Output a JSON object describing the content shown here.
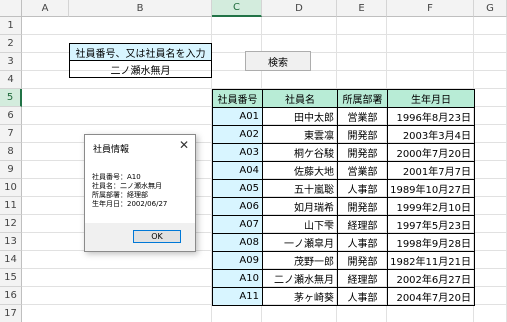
{
  "sheet": {
    "columns": [
      "A",
      "B",
      "C",
      "D",
      "E",
      "F",
      "G"
    ],
    "rows": [
      "1",
      "2",
      "3",
      "4",
      "5",
      "6",
      "7",
      "8",
      "9",
      "10",
      "11",
      "12",
      "13",
      "14",
      "15",
      "16",
      "17"
    ],
    "selected_column": "C",
    "selected_row": "5"
  },
  "search": {
    "label": "社員番号、又は社員名を入力",
    "value": "二ノ瀬水無月",
    "button_label": "検索"
  },
  "table": {
    "headers": [
      "社員番号",
      "社員名",
      "所属部署",
      "生年月日"
    ],
    "rows": [
      [
        "A01",
        "田中太郎",
        "営業部",
        "1996年8月23日"
      ],
      [
        "A02",
        "東雲凛",
        "開発部",
        "2003年3月4日"
      ],
      [
        "A03",
        "桐ケ谷駿",
        "開発部",
        "2000年7月20日"
      ],
      [
        "A04",
        "佐藤大地",
        "営業部",
        "2001年7月7日"
      ],
      [
        "A05",
        "五十嵐聡",
        "人事部",
        "1989年10月27日"
      ],
      [
        "A06",
        "如月瑞希",
        "開発部",
        "1999年2月10日"
      ],
      [
        "A07",
        "山下雫",
        "経理部",
        "1997年5月23日"
      ],
      [
        "A08",
        "一ノ瀬皐月",
        "人事部",
        "1998年9月28日"
      ],
      [
        "A09",
        "茂野一郎",
        "開発部",
        "1982年11月21日"
      ],
      [
        "A10",
        "二ノ瀬水無月",
        "経理部",
        "2002年6月27日"
      ],
      [
        "A11",
        "茅ヶ崎葵",
        "人事部",
        "2004年7月20日"
      ]
    ]
  },
  "dialog": {
    "title": "社員情報",
    "close_glyph": "✕",
    "lines": [
      "社員番号：A10",
      "社員名：二ノ瀬水無月",
      "所属部署：経理部",
      "生年月日：2002/06/27"
    ],
    "ok_label": "OK"
  },
  "colors": {
    "header_fill": "#b8ecd6",
    "id_fill": "#d8f5ff",
    "accent": "#217346"
  }
}
